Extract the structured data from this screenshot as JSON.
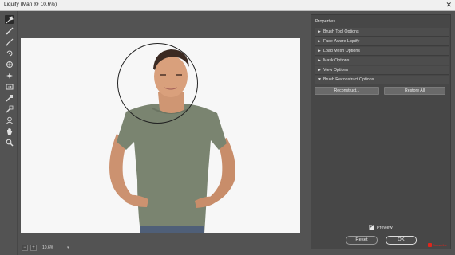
{
  "window": {
    "title": "Liquify (Man @ 10.6%)",
    "close_glyph": "✕"
  },
  "tools": [
    {
      "icon": "forward-warp-tool-icon"
    },
    {
      "icon": "reconstruct-tool-icon"
    },
    {
      "icon": "smooth-tool-icon"
    },
    {
      "icon": "twirl-clockwise-tool-icon"
    },
    {
      "icon": "pucker-tool-icon"
    },
    {
      "icon": "bloat-tool-icon"
    },
    {
      "icon": "push-left-tool-icon"
    },
    {
      "icon": "freeze-mask-tool-icon"
    },
    {
      "icon": "thaw-mask-tool-icon"
    },
    {
      "icon": "face-tool-icon"
    },
    {
      "icon": "hand-tool-icon"
    },
    {
      "icon": "zoom-tool-icon"
    }
  ],
  "status": {
    "zoom_out": "−",
    "zoom_in": "+",
    "zoom_value": "10.6%",
    "zoom_arrow": "▾"
  },
  "properties": {
    "title": "Properties",
    "sections": [
      {
        "label": "Brush Tool Options",
        "expanded": false
      },
      {
        "label": "Face-Aware Liquify",
        "expanded": false
      },
      {
        "label": "Load Mesh Options",
        "expanded": false
      },
      {
        "label": "Mask Options",
        "expanded": false
      },
      {
        "label": "View Options",
        "expanded": false
      },
      {
        "label": "Brush Reconstruct Options",
        "expanded": true
      }
    ],
    "reconstruct_label": "Reconstruct...",
    "restore_all_label": "Restore All",
    "triangle_collapsed": "▶",
    "triangle_expanded": "▼"
  },
  "preview": {
    "label": "Preview",
    "checked": true,
    "check_glyph": "✓"
  },
  "buttons": {
    "reset": "Reset",
    "ok": "OK"
  },
  "watermark": {
    "icon": "youtube-icon",
    "text": "Subscribe"
  },
  "colors": {
    "ui_gray": "#535353",
    "panel_dark": "#474747",
    "canvas_bg": "#ffffff",
    "shirt": "#7a8470",
    "skin": "#d9a07c",
    "youtube_red": "#e1251b"
  }
}
